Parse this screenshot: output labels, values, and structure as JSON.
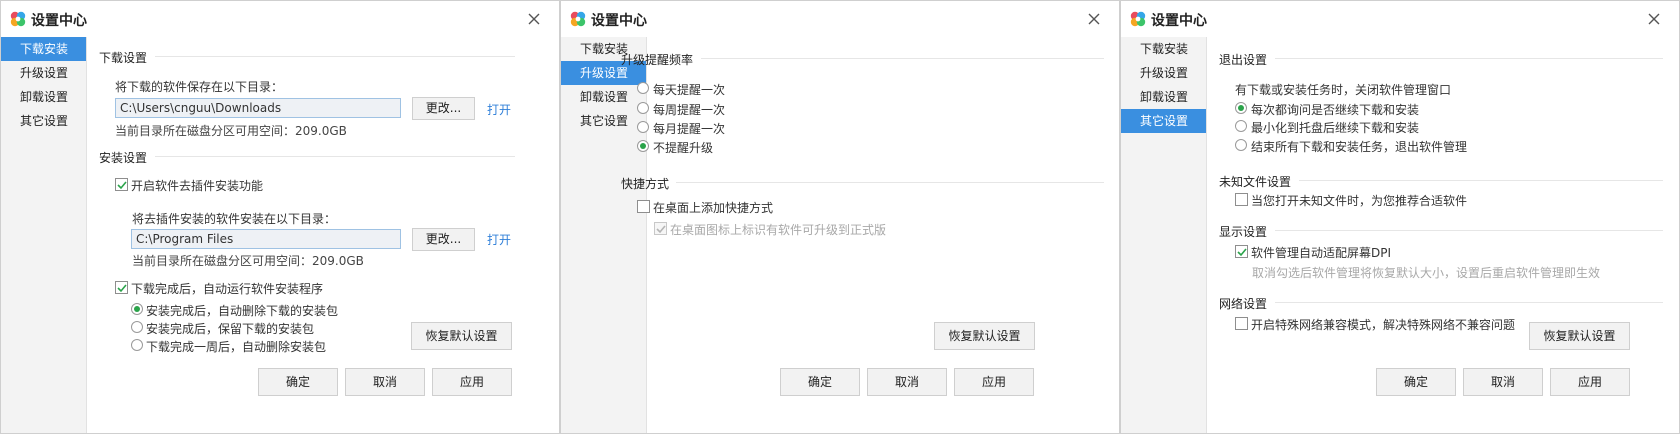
{
  "app_title": "设置中心",
  "nav": [
    "下载安装",
    "升级设置",
    "卸载设置",
    "其它设置"
  ],
  "footer": {
    "ok": "确定",
    "cancel": "取消",
    "apply": "应用",
    "restore": "恢复默认设置"
  },
  "download_panel": {
    "download_section": "下载设置",
    "save_label": "将下载的软件保存在以下目录：",
    "download_path": "C:\\Users\\cnguu\\Downloads",
    "change_btn": "更改...",
    "open_link": "打开",
    "space_note": "当前目录所在磁盘分区可用空间：209.0GB",
    "install_section": "安装设置",
    "plugin_check": "开启软件去插件安装功能",
    "install_label": "将去插件安装的软件安装在以下目录：",
    "install_path": "C:\\Program Files",
    "change_btn2": "更改...",
    "open_link2": "打开",
    "space_note2": "当前目录所在磁盘分区可用空间：209.0GB",
    "autorun_check": "下载完成后，自动运行软件安装程序",
    "options": [
      "安装完成后，自动删除下载的安装包",
      "安装完成后，保留下载的安装包",
      "下载完成一周后，自动删除安装包"
    ]
  },
  "upgrade_panel": {
    "freq_section": "升级提醒频率",
    "options": [
      "每天提醒一次",
      "每周提醒一次",
      "每月提醒一次",
      "不提醒升级"
    ],
    "shortcut_section": "快捷方式",
    "desktop_check": "在桌面上添加快捷方式",
    "badge_check": "在桌面图标上标识有软件可升级到正式版"
  },
  "other_panel": {
    "exit_section": "退出设置",
    "exit_label": "有下载或安装任务时，关闭软件管理窗口",
    "exit_options": [
      "每次都询问是否继续下载和安装",
      "最小化到托盘后继续下载和安装",
      "结束所有下载和安装任务，退出软件管理"
    ],
    "unknown_section": "未知文件设置",
    "unknown_check": "当您打开未知文件时，为您推荐合适软件",
    "display_section": "显示设置",
    "dpi_check": "软件管理自动适配屏幕DPI",
    "dpi_note": "取消勾选后软件管理将恢复默认大小，设置后重启软件管理即生效",
    "network_section": "网络设置",
    "network_check": "开启特殊网络兼容模式，解决特殊网络不兼容问题"
  },
  "colors": {
    "accent": "#3a8fe0",
    "radio_selected": "#2aa34a",
    "link": "#2f7fd8"
  }
}
